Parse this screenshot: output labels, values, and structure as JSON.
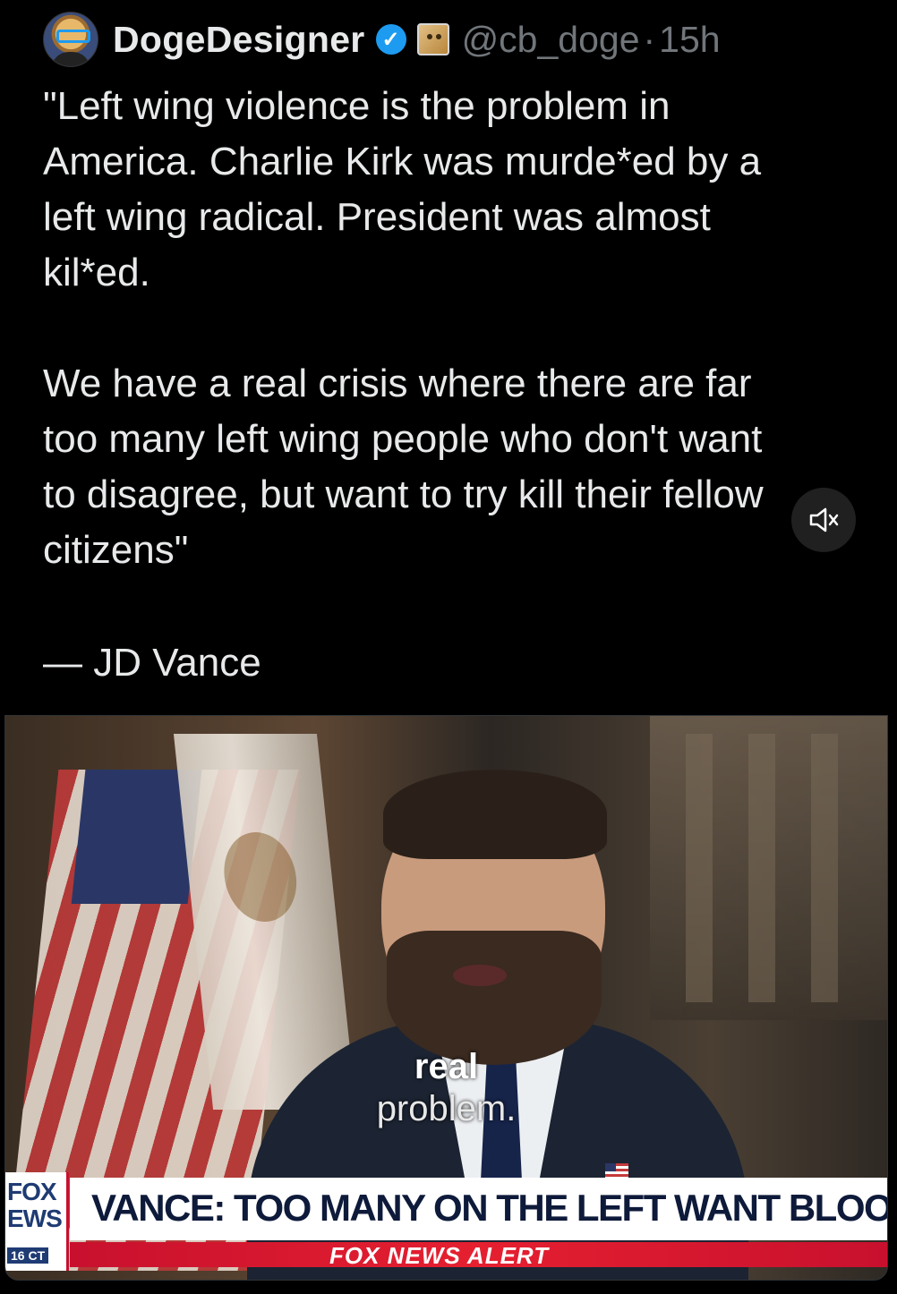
{
  "post": {
    "author": {
      "display_name": "DogeDesigner",
      "handle": "@cb_doge",
      "verified_icon": "verified-check-icon",
      "affiliate_icon": "doge-affiliate-badge"
    },
    "separator": "·",
    "timestamp": "15h",
    "text_lines_para1": [
      "\"Left wing violence is the problem in",
      "America. Charlie Kirk was murde*ed by a",
      "left wing radical. President was almost",
      "kil*ed."
    ],
    "text_lines_para2": [
      "We have a real crisis where there are far",
      "too many left wing people who don't want",
      "to disagree, but want to try kill their fellow",
      "citizens\""
    ],
    "signature": "— JD Vance"
  },
  "video": {
    "caption_line1": "real",
    "caption_line2": "problem.",
    "chyron": {
      "logo_line1": "FOX",
      "logo_line2": "EWS",
      "logo_time": "16 CT",
      "headline": "VANCE: TOO MANY ON THE LEFT WANT BLOOD",
      "alert": "FOX NEWS ALERT"
    },
    "mute_icon": "speaker-muted-icon"
  },
  "colors": {
    "background": "#000000",
    "text": "#e7e9ea",
    "muted_text": "#71767b",
    "verified_blue": "#1d9bf0",
    "fox_red": "#c8102e",
    "fox_navy": "#1f3b73"
  }
}
